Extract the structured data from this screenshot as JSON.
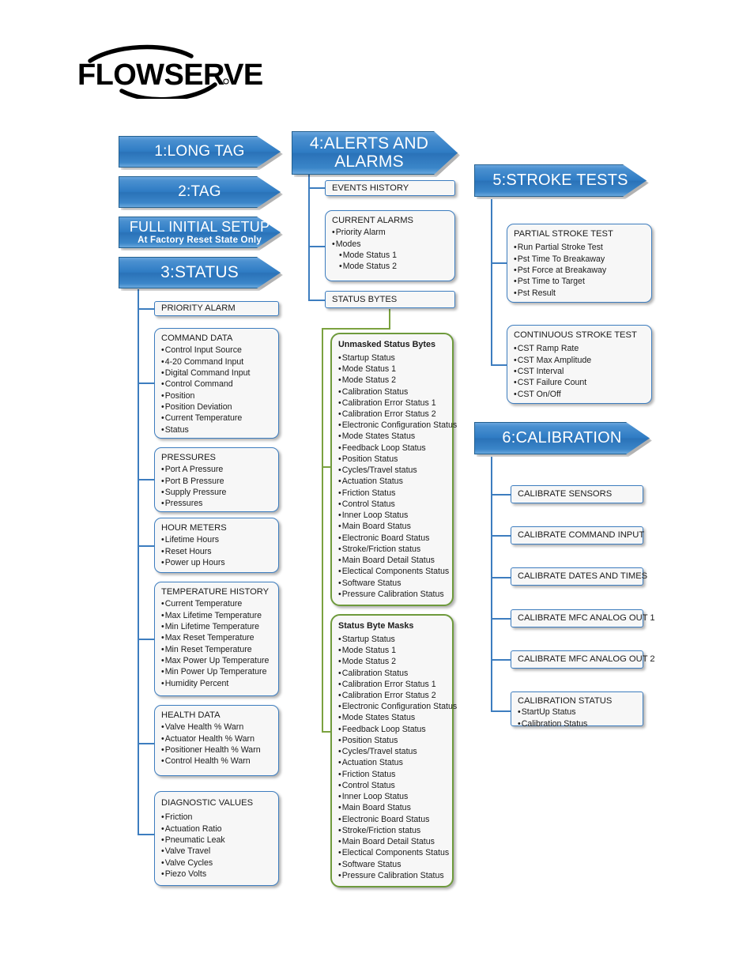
{
  "logo": {
    "wordmark": "FLOWSERVE",
    "registered": "®"
  },
  "banners": [
    {
      "id": "long-tag",
      "label": "1:LONG TAG",
      "sub": ""
    },
    {
      "id": "tag",
      "label": "2:TAG",
      "sub": ""
    },
    {
      "id": "initial-setup",
      "label": "FULL INITIAL SETUP",
      "sub": "At Factory Reset State Only"
    },
    {
      "id": "status",
      "label": "3:STATUS",
      "sub": ""
    },
    {
      "id": "alerts",
      "label": "4:ALERTS AND ALARMS",
      "sub": ""
    },
    {
      "id": "stroke-tests",
      "label": "5:STROKE TESTS",
      "sub": ""
    },
    {
      "id": "calibration",
      "label": "6:CALIBRATION",
      "sub": ""
    }
  ],
  "status_boxes": {
    "priority_alarm": {
      "title": "PRIORITY ALARM",
      "items": []
    },
    "command_data": {
      "title": "COMMAND DATA",
      "items": [
        "Control Input Source",
        "4-20 Command Input",
        "Digital Command Input",
        "Control Command",
        "Position",
        "Position Deviation",
        "Current Temperature",
        "Status"
      ]
    },
    "pressures": {
      "title": "PRESSURES",
      "items": [
        "Port A Pressure",
        "Port B Pressure",
        "Supply Pressure",
        "Pressures"
      ]
    },
    "hour_meters": {
      "title": "HOUR METERS",
      "items": [
        "Lifetime Hours",
        "Reset Hours",
        "Power up Hours"
      ]
    },
    "temperature_history": {
      "title": "TEMPERATURE HISTORY",
      "items": [
        "Current Temperature",
        "Max Lifetime Temperature",
        "Min Lifetime Temperature",
        "Max Reset Temperature",
        "Min Reset Temperature",
        "Max Power Up Temperature",
        "Min Power Up Temperature",
        "Humidity Percent"
      ]
    },
    "health_data": {
      "title": "HEALTH DATA",
      "items": [
        "Valve Health % Warn",
        "Actuator Health % Warn",
        "Positioner Health % Warn",
        "Control Health % Warn"
      ]
    },
    "diagnostic_values": {
      "title": "DIAGNOSTIC VALUES",
      "items": [
        "Friction",
        "Actuation Ratio",
        "Pneumatic Leak",
        "Valve Travel",
        "Valve Cycles",
        "Piezo Volts"
      ]
    }
  },
  "alerts_boxes": {
    "events_history": {
      "title": "EVENTS HISTORY",
      "items": []
    },
    "current_alarms": {
      "title": "CURRENT ALARMS",
      "items": [
        "Priority Alarm",
        "Modes"
      ],
      "subitems": [
        "Mode Status 1",
        "Mode Status 2"
      ]
    },
    "status_bytes": {
      "title": "STATUS BYTES",
      "items": []
    },
    "unmasked_status_bytes": {
      "title": "Unmasked Status Bytes",
      "items": [
        "Startup Status",
        "Mode Status 1",
        "Mode Status 2",
        "Calibration Status",
        "Calibration Error Status 1",
        "Calibration Error Status 2",
        "Electronic Configuration Status",
        "Mode States Status",
        "Feedback Loop Status",
        "Position Status",
        "Cycles/Travel status",
        "Actuation Status",
        "Friction Status",
        "Control Status",
        "Inner Loop Status",
        "Main Board Status",
        "Electronic Board Status",
        "Stroke/Friction status",
        "Main Board Detail Status",
        "Electical Components Status",
        "Software Status",
        "Pressure Calibration Status"
      ]
    },
    "status_byte_masks": {
      "title": "Status Byte Masks",
      "items": [
        "Startup Status",
        "Mode Status 1",
        "Mode Status 2",
        "Calibration Status",
        "Calibration Error Status 1",
        "Calibration Error Status 2",
        "Electronic Configuration Status",
        "Mode States Status",
        "Feedback Loop Status",
        "Position Status",
        "Cycles/Travel status",
        "Actuation Status",
        "Friction Status",
        "Control Status",
        "Inner Loop Status",
        "Main Board Status",
        "Electronic Board Status",
        "Stroke/Friction status",
        "Main Board Detail Status",
        "Electical Components Status",
        "Software Status",
        "Pressure Calibration Status"
      ]
    }
  },
  "stroke_boxes": {
    "partial_stroke_test": {
      "title": "PARTIAL STROKE TEST",
      "items": [
        "Run Partial Stroke Test",
        "Pst Time To Breakaway",
        "Pst Force at Breakaway",
        "Pst Time to Target",
        "Pst Result"
      ]
    },
    "continuous_stroke_test": {
      "title": "CONTINUOUS STROKE TEST",
      "items": [
        "CST Ramp Rate",
        "CST Max Amplitude",
        "CST Interval",
        "CST Failure Count",
        "CST On/Off"
      ]
    }
  },
  "calibration_boxes": {
    "calibrate_sensors": {
      "title": "CALIBRATE SENSORS",
      "items": []
    },
    "calibrate_command_input": {
      "title": "CALIBRATE COMMAND INPUT",
      "items": []
    },
    "calibrate_dates_times": {
      "title": "CALIBRATE DATES AND TIMES",
      "items": []
    },
    "calibrate_mfc_out1": {
      "title": "CALIBRATE MFC ANALOG OUT 1",
      "items": []
    },
    "calibrate_mfc_out2": {
      "title": "CALIBRATE MFC ANALOG OUT 2",
      "items": []
    },
    "calibration_status": {
      "title": "CALIBRATION STATUS",
      "items": [
        "StartUp Status",
        "Calibration Status"
      ]
    }
  },
  "colors": {
    "banner_blue": "#2f7cc4",
    "box_border_blue": "#3d7dbf",
    "box_border_green": "#6e9a3c",
    "connector_green": "#7ba23f",
    "box_fill": "#f7f7f7"
  }
}
